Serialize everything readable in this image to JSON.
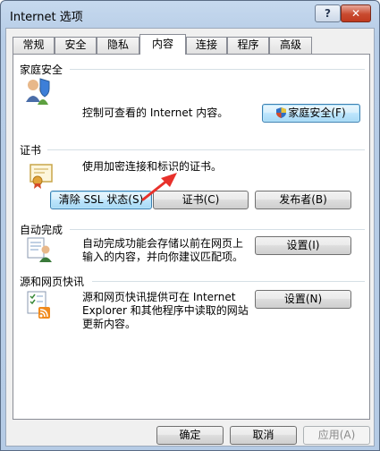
{
  "window": {
    "title": "Internet 选项",
    "help_label": "?",
    "close_label": "✕"
  },
  "tabs": [
    {
      "label": "常规"
    },
    {
      "label": "安全"
    },
    {
      "label": "隐私"
    },
    {
      "label": "内容"
    },
    {
      "label": "连接"
    },
    {
      "label": "程序"
    },
    {
      "label": "高级"
    }
  ],
  "family_safety": {
    "title": "家庭安全",
    "description": "控制可查看的 Internet 内容。",
    "button_label": "家庭安全(F)"
  },
  "certificates": {
    "title": "证书",
    "description": "使用加密连接和标识的证书。",
    "clear_ssl_label": "清除 SSL 状态(S)",
    "certificates_label": "证书(C)",
    "publishers_label": "发布者(B)"
  },
  "autocomplete": {
    "title": "自动完成",
    "description_line1": "自动完成功能会存储以前在网页上",
    "description_line2": "输入的内容，并向你建议匹配项。",
    "settings_label": "设置(I)"
  },
  "feeds": {
    "title": "源和网页快讯",
    "description_line1": "源和网页快讯提供可在 Internet",
    "description_line2": "Explorer 和其他程序中读取的网站",
    "description_line3": "更新内容。",
    "settings_label": "设置(N)"
  },
  "footer": {
    "ok_label": "确定",
    "cancel_label": "取消",
    "apply_label": "应用(A)"
  },
  "colors": {
    "annotation_arrow": "#e8312b",
    "focus_border": "#3c7fb1"
  }
}
